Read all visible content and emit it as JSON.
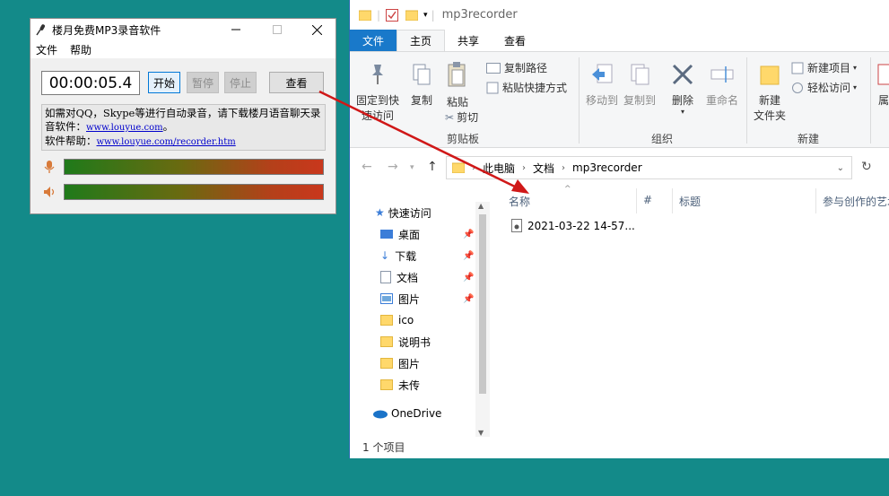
{
  "recorder": {
    "title": "楼月免费MP3录音软件",
    "menu": [
      "文件",
      "帮助"
    ],
    "time": "00:00:05.4",
    "buttons": {
      "start": "开始",
      "pause": "暂停",
      "stop": "停止",
      "view": "查看"
    },
    "info_line1": "如需对QQ，Skype等进行自动录音，请下载楼月语音聊天录",
    "info_line2_prefix": "音软件：",
    "info_link1": "www.louyue.com",
    "info_line2_suffix": "。",
    "info_line3_prefix": "软件帮助：",
    "info_link2": "www.louyue.com/recorder.htm"
  },
  "explorer": {
    "qa_path": "mp3recorder",
    "tabs": {
      "file": "文件",
      "home": "主页",
      "share": "共享",
      "view": "查看"
    },
    "ribbon": {
      "pin": [
        "固定到快",
        "速访问"
      ],
      "copy": "复制",
      "paste": "粘贴",
      "copy_path": "复制路径",
      "paste_shortcut": "粘贴快捷方式",
      "cut": "剪切",
      "clipboard": "剪贴板",
      "move_to": "移动到",
      "copy_to": "复制到",
      "delete": "删除",
      "rename": "重命名",
      "organize": "组织",
      "new_folder": [
        "新建",
        "文件夹"
      ],
      "new_item": "新建项目",
      "easy_access": "轻松访问",
      "new": "新建",
      "attr_partial": "属"
    },
    "address": {
      "root": "此电脑",
      "docs": "文档",
      "folder": "mp3recorder"
    },
    "tree": {
      "quick_access": "快速访问",
      "desktop": "桌面",
      "downloads": "下载",
      "documents": "文档",
      "pictures": "图片",
      "ico": "ico",
      "manual": "说明书",
      "pictures2": "图片",
      "unsent": "未传",
      "onedrive": "OneDrive"
    },
    "columns": {
      "name": "名称",
      "num": "#",
      "title": "标题",
      "artists": "参与创作的艺术"
    },
    "file_name": "2021-03-22 14-57...",
    "status": "1 个项目"
  }
}
